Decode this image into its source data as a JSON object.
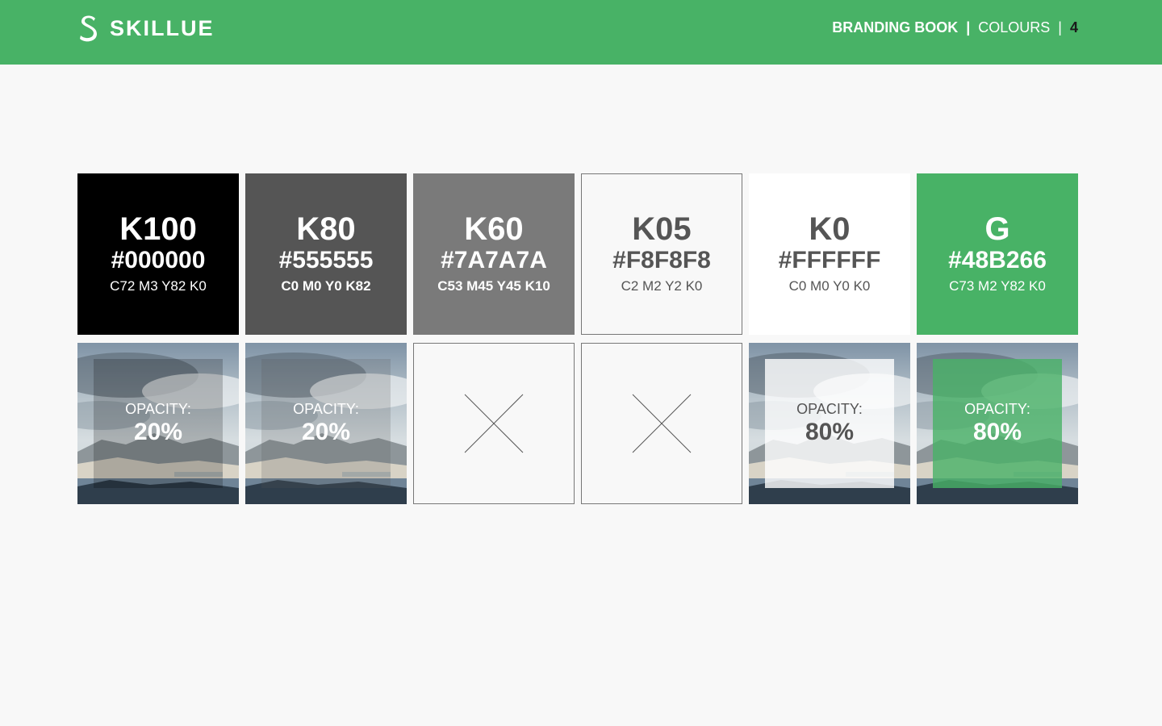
{
  "header": {
    "brand": "SKILLUE",
    "book": "BRANDING BOOK",
    "separator": "|",
    "section": "COLOURS",
    "page": "4",
    "background": "#48B266"
  },
  "swatches": [
    {
      "name": "K100",
      "hex": "#000000",
      "cmyk": "C72 M3 Y82 K0",
      "color": "#000000",
      "text_color": "#FFFFFF",
      "cmyk_bold": false
    },
    {
      "name": "K80",
      "hex": "#555555",
      "cmyk": "C0 M0 Y0 K82",
      "color": "#555555",
      "text_color": "#FFFFFF",
      "cmyk_bold": true
    },
    {
      "name": "K60",
      "hex": "#7A7A7A",
      "cmyk": "C53 M45 Y45 K10",
      "color": "#7A7A7A",
      "text_color": "#FFFFFF",
      "cmyk_bold": true
    },
    {
      "name": "K05",
      "hex": "#F8F8F8",
      "cmyk": "C2 M2 Y2 K0",
      "color": "#F8F8F8",
      "text_color": "#555555",
      "cmyk_bold": false
    },
    {
      "name": "K0",
      "hex": "#FFFFFF",
      "cmyk": "C0 M0 Y0 K0",
      "color": "#FFFFFF",
      "text_color": "#555555",
      "cmyk_bold": false
    },
    {
      "name": "G",
      "hex": "#48B266",
      "cmyk": "C73 M2 Y82 K0",
      "color": "#48B266",
      "text_color": "#FFFFFF",
      "cmyk_bold": false
    }
  ],
  "opacity_samples": [
    {
      "type": "photo",
      "label": "OPACITY:",
      "value": "20%",
      "overlay_color": "#000000",
      "overlay_opacity": 0.2,
      "text_color": "#FFFFFF"
    },
    {
      "type": "photo",
      "label": "OPACITY:",
      "value": "20%",
      "overlay_color": "#555555",
      "overlay_opacity": 0.2,
      "text_color": "#FFFFFF"
    },
    {
      "type": "none"
    },
    {
      "type": "none"
    },
    {
      "type": "photo",
      "label": "OPACITY:",
      "value": "80%",
      "overlay_color": "#FFFFFF",
      "overlay_opacity": 0.8,
      "text_color": "#555555"
    },
    {
      "type": "photo",
      "label": "OPACITY:",
      "value": "80%",
      "overlay_color": "#48B266",
      "overlay_opacity": 0.8,
      "text_color": "#FFFFFF"
    }
  ]
}
